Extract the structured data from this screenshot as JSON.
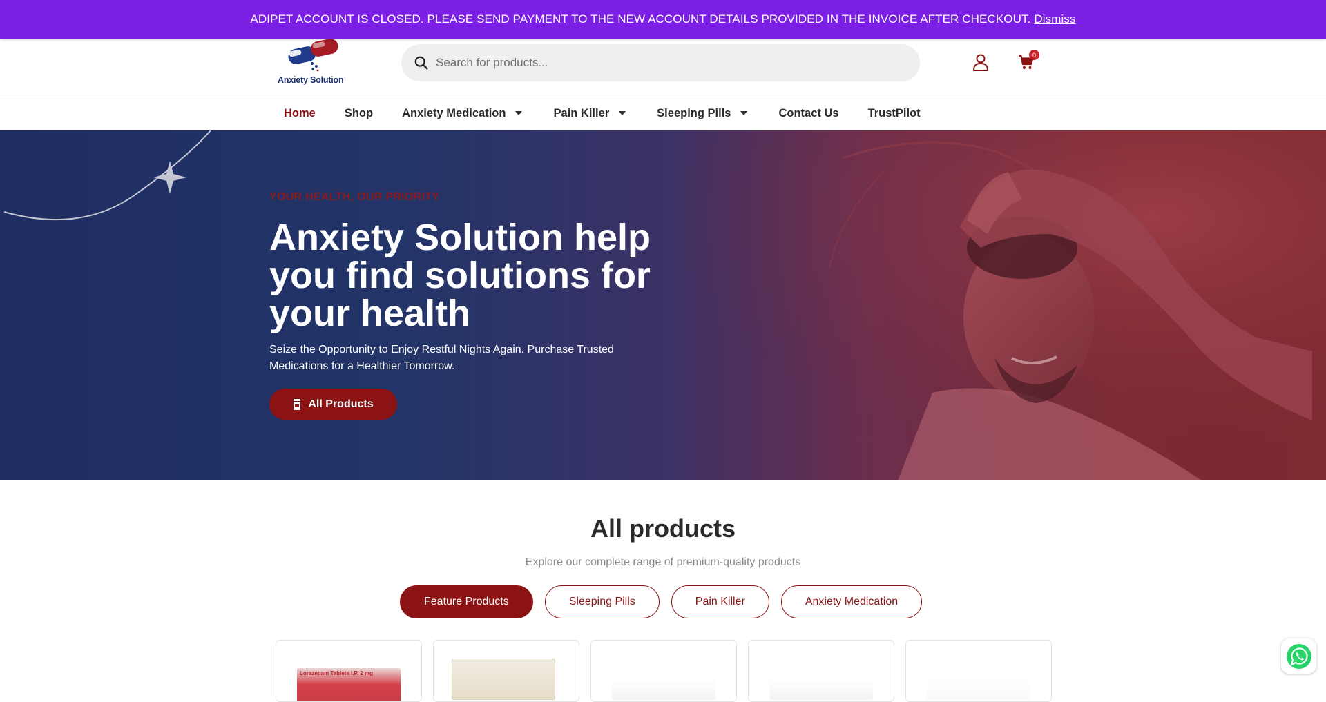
{
  "notice": {
    "text": "ADIPET ACCOUNT IS CLOSED. PLEASE SEND PAYMENT TO THE NEW ACCOUNT DETAILS PROVIDED IN THE INVOICE AFTER CHECKOUT.",
    "dismiss_label": "Dismiss",
    "background": "#7b1fe4"
  },
  "header": {
    "logo_text": "Anxiety Solution",
    "search_placeholder": "Search for products...",
    "cart_count": "0"
  },
  "nav": {
    "items": [
      {
        "label": "Home",
        "active": true
      },
      {
        "label": "Shop"
      },
      {
        "label": "Anxiety Medication",
        "dropdown": true
      },
      {
        "label": "Pain Killer",
        "dropdown": true
      },
      {
        "label": "Sleeping Pills",
        "dropdown": true
      },
      {
        "label": "Contact Us"
      },
      {
        "label": "TrustPilot"
      }
    ]
  },
  "hero": {
    "kicker": "YOUR HEALTH, OUR PRIORITY",
    "title": "Anxiety Solution help you find solutions for your health",
    "subtitle": "Seize the Opportunity to Enjoy Restful Nights Again. Purchase Trusted Medications for a Healthier Tomorrow.",
    "cta_label": "All Products"
  },
  "products": {
    "title": "All products",
    "subtitle": "Explore our complete range of premium-quality products",
    "filters": [
      {
        "label": "Feature Products",
        "active": true
      },
      {
        "label": "Sleeping Pills"
      },
      {
        "label": "Pain Killer"
      },
      {
        "label": "Anxiety Medication"
      }
    ],
    "cards": [
      {
        "thumb_text": "Lorazepam Tablets I.P. 2 mg"
      },
      {},
      {},
      {},
      {}
    ]
  },
  "colors": {
    "brand_red": "#8b1313",
    "navy": "#1f2e62",
    "whatsapp_green": "#25d366"
  },
  "icons": [
    "search-icon",
    "user-icon",
    "cart-icon",
    "bottle-icon",
    "whatsapp-icon"
  ]
}
